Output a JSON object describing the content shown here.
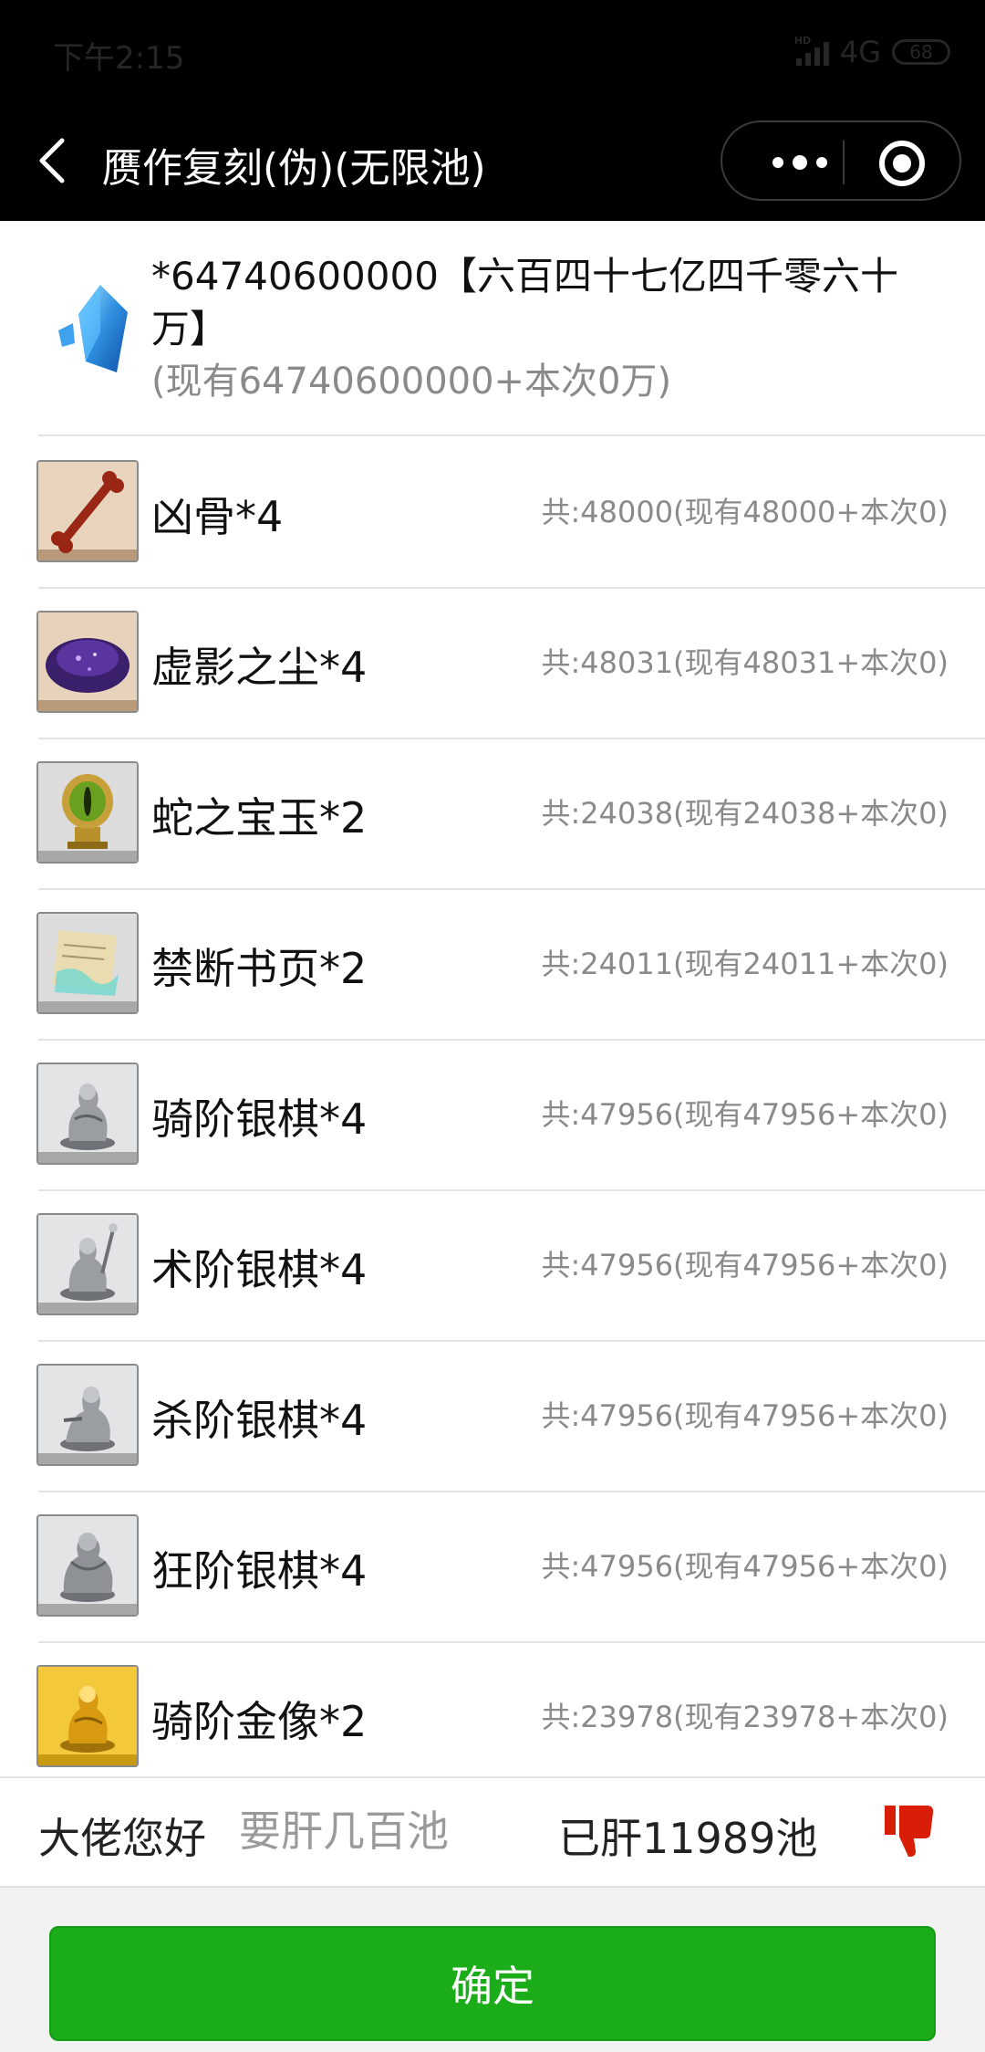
{
  "status_bar": {
    "time": "下午2:15",
    "signal_badge": "HD",
    "network": "4G",
    "battery": "68"
  },
  "nav": {
    "back_icon": "chevron-left-icon",
    "title": "赝作复刻(伪)(无限池)",
    "more_icon": "more-dots-icon",
    "close_icon": "target-circle-icon"
  },
  "summary": {
    "icon": "blue-crystal-icon",
    "main": "*64740600000【六百四十七亿四千零六十万】",
    "sub": "(现有64740600000+本次0万)"
  },
  "items": [
    {
      "name": "凶骨*4",
      "total": "共:48000(现有48000+本次0)",
      "icon": "bone-icon"
    },
    {
      "name": "虚影之尘*4",
      "total": "共:48031(现有48031+本次0)",
      "icon": "purple-dust-icon"
    },
    {
      "name": "蛇之宝玉*2",
      "total": "共:24038(现有24038+本次0)",
      "icon": "serpent-jewel-icon"
    },
    {
      "name": "禁断书页*2",
      "total": "共:24011(现有24011+本次0)",
      "icon": "forbidden-page-icon"
    },
    {
      "name": "骑阶银棋*4",
      "total": "共:47956(现有47956+本次0)",
      "icon": "silver-rider-piece-icon"
    },
    {
      "name": "术阶银棋*4",
      "total": "共:47956(现有47956+本次0)",
      "icon": "silver-caster-piece-icon"
    },
    {
      "name": "杀阶银棋*4",
      "total": "共:47956(现有47956+本次0)",
      "icon": "silver-assassin-piece-icon"
    },
    {
      "name": "狂阶银棋*4",
      "total": "共:47956(现有47956+本次0)",
      "icon": "silver-berserker-piece-icon"
    },
    {
      "name": "骑阶金像*2",
      "total": "共:23978(现有23978+本次0)",
      "icon": "gold-rider-statue-icon"
    }
  ],
  "input_bar": {
    "greeting": "大佬您好",
    "placeholder": "要肝几百池",
    "done_count": "已肝11989池",
    "thumb_icon": "thumbs-down-icon"
  },
  "confirm_label": "确定",
  "colors": {
    "accent_green": "#1aad19",
    "thumb_red": "#d81e06",
    "muted_text": "#8a8a8a"
  }
}
